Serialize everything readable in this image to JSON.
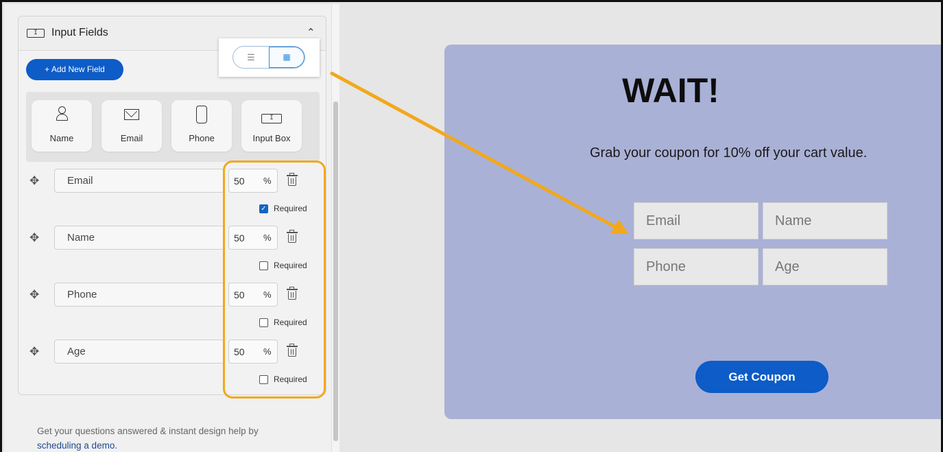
{
  "panel": {
    "title": "Input Fields",
    "chevron": "^",
    "add_button": "+ Add New Field",
    "view_toggle": {
      "list_icon": "list-icon",
      "grid_icon": "grid-icon",
      "selected": "grid"
    },
    "field_types": [
      {
        "label": "Name",
        "icon": "person-icon"
      },
      {
        "label": "Email",
        "icon": "mail-icon"
      },
      {
        "label": "Phone",
        "icon": "phone-icon"
      },
      {
        "label": "Input Box",
        "icon": "input-box-icon"
      }
    ],
    "fields": [
      {
        "name": "Email",
        "width": "50",
        "unit": "%",
        "required_label": "Required",
        "required": true
      },
      {
        "name": "Name",
        "width": "50",
        "unit": "%",
        "required_label": "Required",
        "required": false
      },
      {
        "name": "Phone",
        "width": "50",
        "unit": "%",
        "required_label": "Required",
        "required": false
      },
      {
        "name": "Age",
        "width": "50",
        "unit": "%",
        "required_label": "Required",
        "required": false
      }
    ],
    "help_text": "Get your questions answered & instant design help by",
    "help_link": "scheduling a demo."
  },
  "preview": {
    "headline": "WAIT!",
    "subtext": "Grab your coupon for 10% off your cart value.",
    "fields": [
      "Email",
      "Name",
      "Phone",
      "Age"
    ],
    "button": "Get Coupon"
  },
  "colors": {
    "primary": "#0d5cc7",
    "highlight": "#f2a81c",
    "preview_bg": "#aab1d6"
  }
}
